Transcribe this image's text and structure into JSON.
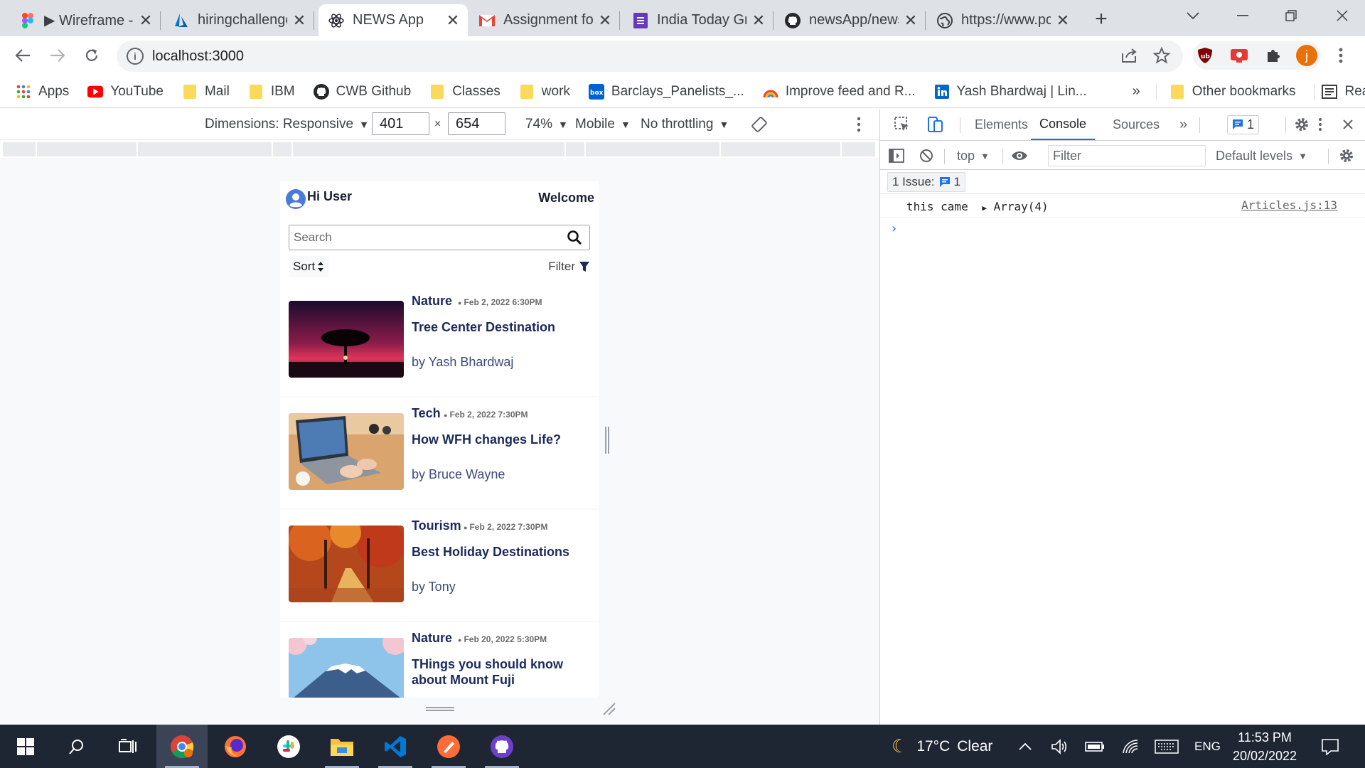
{
  "browser": {
    "tabs": [
      {
        "title": "▶ Wirefrаme -",
        "icon": "figma-icon"
      },
      {
        "title": "hiringchallenge",
        "icon": "azure-icon"
      },
      {
        "title": "NEWS App",
        "icon": "react-icon"
      },
      {
        "title": "Assignment fo",
        "icon": "gmail-icon"
      },
      {
        "title": "India Today Gr",
        "icon": "forms-icon"
      },
      {
        "title": "newsApp/news",
        "icon": "github-icon"
      },
      {
        "title": "https://www.pc",
        "icon": "globe-icon"
      }
    ],
    "url": "localhost:3000",
    "profile_initial": "j",
    "bookmarks": [
      {
        "label": "Apps",
        "icon": "apps-grid-icon"
      },
      {
        "label": "YouTube",
        "icon": "youtube-icon"
      },
      {
        "label": "Mail",
        "icon": "folder-icon"
      },
      {
        "label": "IBM",
        "icon": "folder-icon"
      },
      {
        "label": "CWB Github",
        "icon": "github-icon"
      },
      {
        "label": "Classes",
        "icon": "folder-icon"
      },
      {
        "label": "work",
        "icon": "folder-icon"
      },
      {
        "label": "Barclays_Panelists_...",
        "icon": "box-icon"
      },
      {
        "label": "Improve feed and R...",
        "icon": "rainbow-icon"
      },
      {
        "label": "Yash Bhardwaj | Lin...",
        "icon": "linkedin-icon"
      }
    ],
    "bookmarks_overflow": "»",
    "other_bookmarks": "Other bookmarks",
    "reading_list": "Reading list"
  },
  "device_toolbar": {
    "dimensions": "Dimensions: Responsive",
    "width": "401",
    "times": "×",
    "height": "654",
    "zoom": "74%",
    "device_type": "Mobile",
    "throttling": "No throttling"
  },
  "app": {
    "greeting": "Hi User",
    "welcome": "Welcome",
    "search_placeholder": "Search",
    "sort_label": "Sort",
    "filter_label": "Filter",
    "articles": [
      {
        "category": "Nature",
        "date": "Feb 2, 2022 6:30PM",
        "title": "Tree Center Destination",
        "author": "by Yash Bhardwaj"
      },
      {
        "category": "Tech",
        "date": "Feb 2, 2022 7:30PM",
        "title": "How WFH changes Life?",
        "author": "by Bruce Wayne"
      },
      {
        "category": "Tourism",
        "date": "Feb 2, 2022 7:30PM",
        "title": "Best Holiday Destinations",
        "author": "by Tony"
      },
      {
        "category": "Nature",
        "date": "Feb 20, 2022 5:30PM",
        "title": "THings you should know about Mount Fuji",
        "author": ""
      }
    ]
  },
  "devtools": {
    "tabs": [
      "Elements",
      "Console",
      "Sources"
    ],
    "active_tab": "Console",
    "more": "»",
    "issue_count": "1",
    "context": "top",
    "filter_placeholder": "Filter",
    "levels": "Default levels",
    "issues_label": "1 Issue:",
    "issues_count": "1",
    "console_message": "this came",
    "console_value": "Array(4)",
    "console_source": "Articles.js:13",
    "prompt": "›"
  },
  "taskbar": {
    "weather_temp": "17°C",
    "weather_text": "Clear",
    "language": "ENG",
    "time": "11:53 PM",
    "date": "20/02/2022"
  },
  "colors": {
    "tab_strip": "#dee1e6",
    "accent_blue": "#1a73e8",
    "app_title": "#1a2a5c",
    "taskbar": "#1f2633"
  }
}
